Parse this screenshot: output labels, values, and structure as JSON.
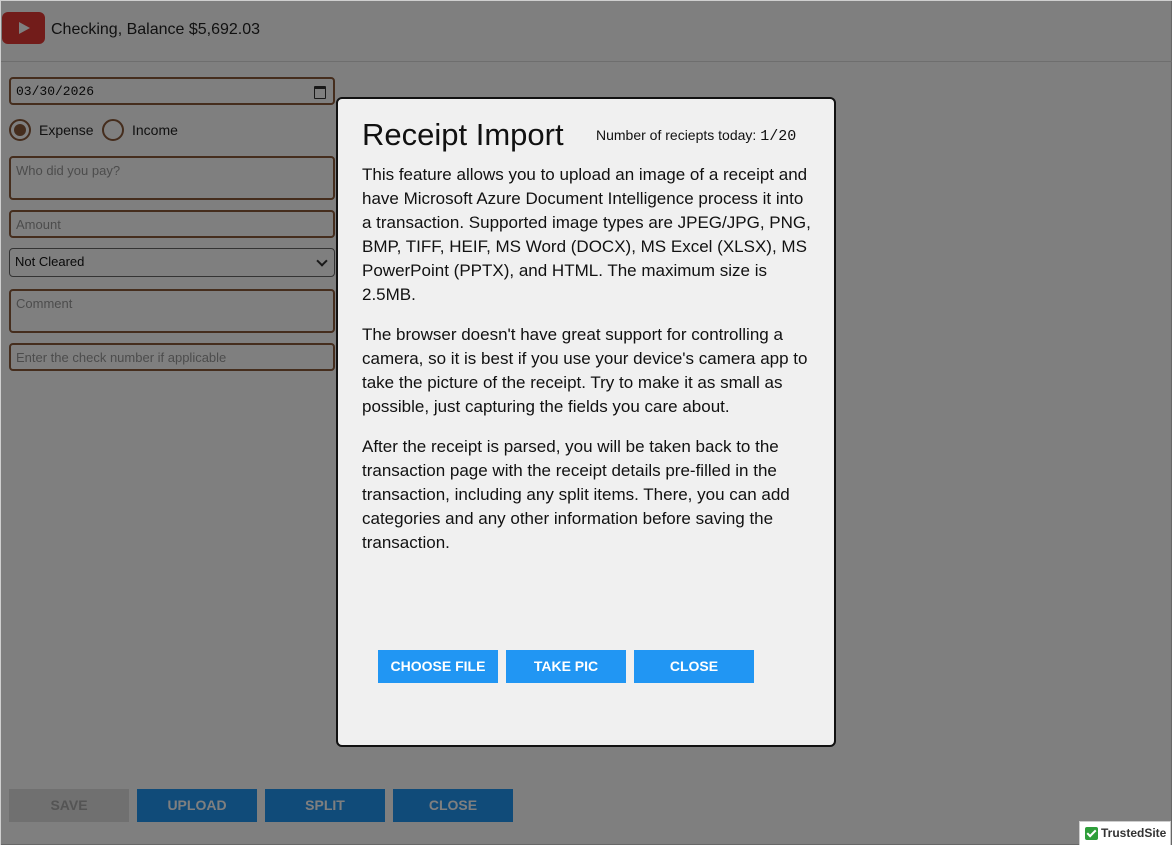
{
  "header": {
    "back_icon": "play-icon",
    "account_title": "Checking, Balance $5,692.03"
  },
  "form": {
    "date_value": "03/30/2026",
    "type_options": [
      {
        "label": "Expense",
        "selected": true
      },
      {
        "label": "Income",
        "selected": false
      }
    ],
    "payee_placeholder": "Who did you pay?",
    "amount_placeholder": "Amount",
    "cleared_value": "Not Cleared",
    "comment_placeholder": "Comment",
    "check_placeholder": "Enter the check number if applicable"
  },
  "actions": {
    "save": "SAVE",
    "upload": "UPLOAD",
    "split": "SPLIT",
    "close": "CLOSE"
  },
  "badge": {
    "label": "TrustedSite"
  },
  "modal": {
    "title": "Receipt Import",
    "count_label": "Number of reciepts today:",
    "count_value": "1/20",
    "paragraphs": [
      "This feature allows you to upload an image of a receipt and have Microsoft Azure Document Intelligence process it into a transaction. Supported image types are JPEG/JPG, PNG, BMP, TIFF, HEIF, MS Word (DOCX), MS Excel (XLSX), MS PowerPoint (PPTX), and HTML. The maximum size is 2.5MB.",
      "The browser doesn't have great support for controlling a camera, so it is best if you use your device's camera app to take the picture of the receipt. Try to make it as small as possible, just capturing the fields you care about.",
      "After the receipt is parsed, you will be taken back to the transaction page with the receipt details pre-filled in the transaction, including any split items. There, you can add categories and any other information before saving the transaction."
    ],
    "buttons": {
      "choose_file": "CHOOSE FILE",
      "take_pic": "TAKE PIC",
      "close": "CLOSE"
    }
  },
  "colors": {
    "accent": "#2196f3",
    "back_button": "#e53935",
    "field_border": "#8a5a3a"
  }
}
